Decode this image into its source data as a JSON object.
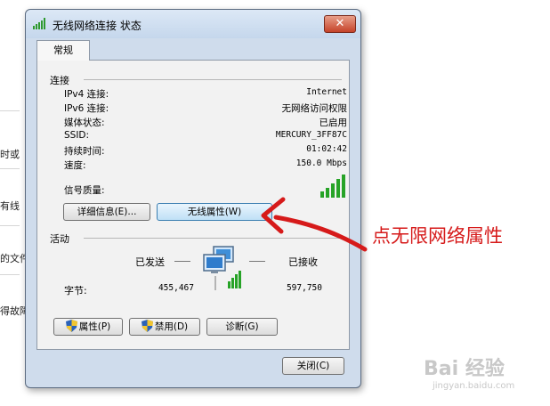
{
  "background_fragments": [
    "时或",
    "有线",
    "的文件",
    "得故障"
  ],
  "dialog": {
    "title": "无线网络连接 状态",
    "close_glyph": "✕",
    "tabs": [
      {
        "label": "常规"
      }
    ]
  },
  "connection": {
    "heading": "连接",
    "rows": [
      {
        "label": "IPv4 连接:",
        "value": "Internet"
      },
      {
        "label": "IPv6 连接:",
        "value": "无网络访问权限"
      },
      {
        "label": "媒体状态:",
        "value": "已启用"
      },
      {
        "label": "SSID:",
        "value": "MERCURY_3FF87C"
      },
      {
        "label": "持续时间:",
        "value": "01:02:42"
      },
      {
        "label": "速度:",
        "value": "150.0 Mbps"
      }
    ],
    "signal_label": "信号质量:",
    "signal_bars": 5,
    "details_button": "详细信息(E)...",
    "wireless_props_button": "无线属性(W)"
  },
  "activity": {
    "heading": "活动",
    "sent_label": "已发送",
    "received_label": "已接收",
    "bytes_label": "字节:",
    "bytes_sent": "455,467",
    "bytes_received": "597,750"
  },
  "buttons": {
    "properties": "属性(P)",
    "disable": "禁用(D)",
    "diagnose": "诊断(G)",
    "close": "关闭(C)"
  },
  "annotation": {
    "text": "点无限网络属性",
    "color": "#d61a1a"
  },
  "watermark": {
    "brand": "Bai 经验",
    "url": "jingyan.baidu.com"
  },
  "icons": [
    "wifi-signal-icon",
    "close-icon",
    "network-computers-icon",
    "shield-icon",
    "red-arrow"
  ]
}
